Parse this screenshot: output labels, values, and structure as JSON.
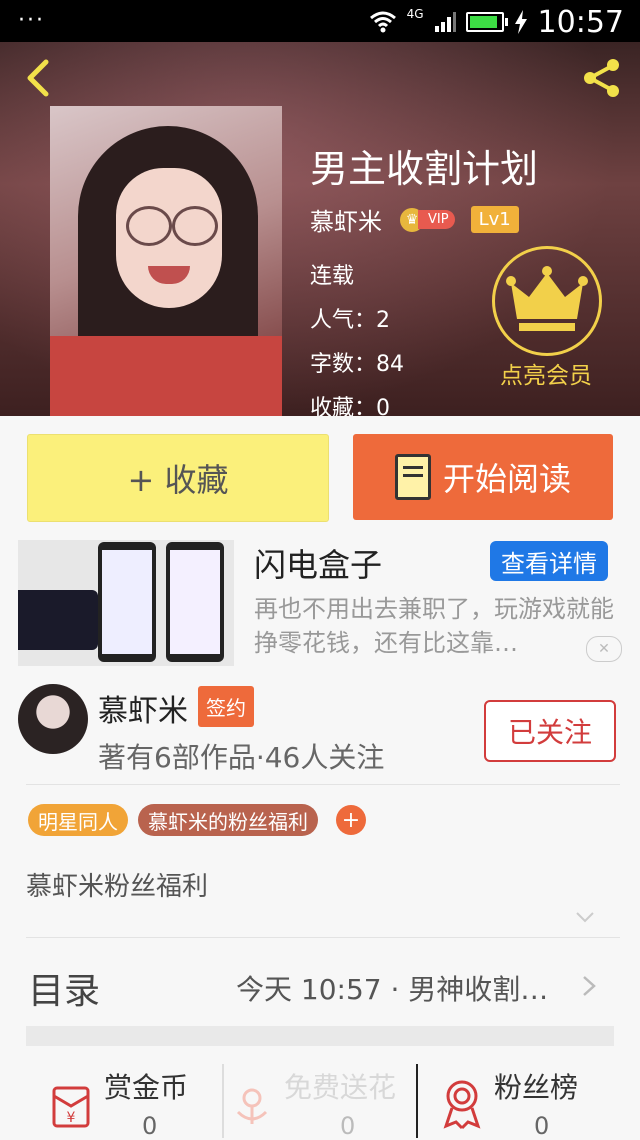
{
  "status_bar": {
    "dots": "···",
    "network": "4G",
    "time": "10:57"
  },
  "book": {
    "title": "男主收割计划",
    "author": "慕虾米",
    "vip_label": "VIP",
    "level": "Lv1",
    "status": "连载",
    "popularity": "人气：2",
    "word_count": "字数：84",
    "favorites": "收藏：0"
  },
  "member": {
    "label": "点亮会员"
  },
  "actions": {
    "collect_label": "+ 收藏",
    "read_label": "开始阅读"
  },
  "ad": {
    "title": "闪电盒子",
    "button_label": "查看详情",
    "description": "再也不用出去兼职了，玩游戏就能挣零花钱，还有比这靠…",
    "close_symbol": "✕"
  },
  "author": {
    "name": "慕虾米",
    "sign_label": "签约",
    "stats": "著有6部作品·46人关注",
    "follow_label": "已关注"
  },
  "tags": [
    {
      "label": "明星同人",
      "color": "#f1a437"
    },
    {
      "label": "慕虾米的粉丝福利",
      "color": "#b9634e"
    }
  ],
  "tag_add": "+",
  "description": "慕虾米粉丝福利",
  "toc": {
    "label": "目录",
    "latest": "今天 10:57 · 男神收割…"
  },
  "bottom": [
    {
      "label": "赏金币",
      "count": "0",
      "icon": "red-packet-icon"
    },
    {
      "label": "免费送花",
      "count": "0",
      "icon": "flower-icon"
    },
    {
      "label": "粉丝榜",
      "count": "0",
      "icon": "medal-icon"
    }
  ]
}
